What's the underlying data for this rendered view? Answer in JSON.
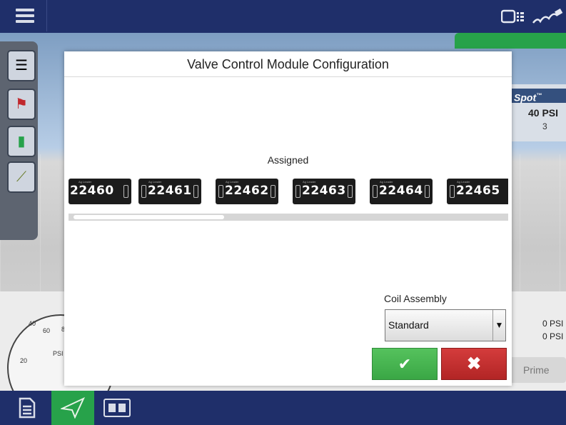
{
  "dialog": {
    "title": "Valve Control Module Configuration",
    "assigned_label": "Assigned",
    "modules": [
      "22460",
      "22461",
      "22462",
      "22463",
      "22464",
      "22465"
    ],
    "module_brand": "Ag Leader",
    "coil_assembly_label": "Coil Assembly",
    "coil_assembly_value": "Standard",
    "ok_icon": "✔",
    "cancel_icon": "✖",
    "scroll_position": 0.0,
    "scroll_visible_fraction": 0.35
  },
  "background": {
    "spot_label": "Spot",
    "spot_tm": "™",
    "pressure_top": "40 PSI",
    "boom_section": "3",
    "pressure_1": "0 PSI",
    "pressure_2": "0 PSI",
    "prime_label": "Prime",
    "gauge": {
      "labels": [
        "20",
        "40",
        "60",
        "8",
        "PSI"
      ]
    }
  },
  "colors": {
    "topbar": "#1f2f6a",
    "accent_green": "#27a24a",
    "ok_green": "#3aa745",
    "cancel_red": "#b22525"
  },
  "icons": {
    "menu": "hamburger-icon",
    "display": "display-icon",
    "gps": "satellite-icon",
    "nav_docs": "document-icon",
    "nav_map": "navigation-arrow-icon",
    "nav_split": "split-view-icon"
  }
}
